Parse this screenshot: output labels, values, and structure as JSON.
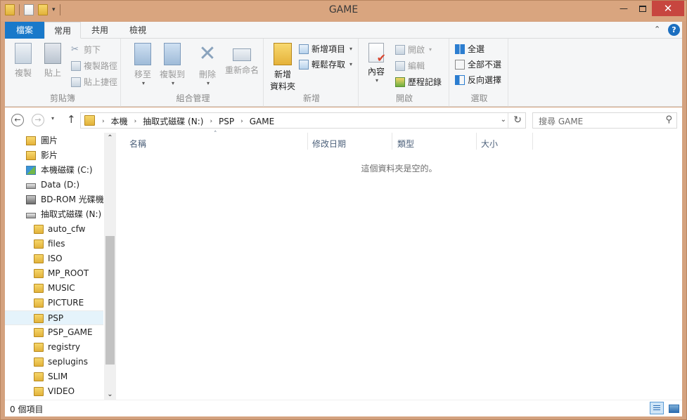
{
  "window": {
    "title": "GAME",
    "close_glyph": "✕",
    "minimize_glyph": "—"
  },
  "quick_access": {
    "icons": [
      "folder-icon",
      "properties-icon",
      "new-folder-icon"
    ],
    "customize_glyph": "▾"
  },
  "ribbon_tabs": [
    {
      "label": "檔案"
    },
    {
      "label": "常用"
    },
    {
      "label": "共用"
    },
    {
      "label": "檢視"
    }
  ],
  "ribbon": {
    "collapse_glyph": "⌃",
    "help_glyph": "?",
    "clipboard": {
      "group_label": "剪貼簿",
      "copy": "複製",
      "paste": "貼上",
      "cut": "剪下",
      "copy_path": "複製路徑",
      "paste_shortcut": "貼上捷徑"
    },
    "organize": {
      "group_label": "組合管理",
      "move_to": "移至",
      "copy_to": "複製到",
      "delete": "刪除",
      "rename": "重新命名"
    },
    "new": {
      "group_label": "新增",
      "new_folder_line1": "新增",
      "new_folder_line2": "資料夾",
      "new_item": "新增項目",
      "easy_access": "輕鬆存取"
    },
    "open": {
      "group_label": "開啟",
      "properties": "內容",
      "open": "開啟",
      "edit": "編輯",
      "history": "歷程記錄"
    },
    "select": {
      "group_label": "選取",
      "select_all": "全選",
      "select_none": "全部不選",
      "invert_selection": "反向選擇"
    }
  },
  "navigation": {
    "back_glyph": "←",
    "forward_glyph": "→",
    "recent_glyph": "▾",
    "up_glyph": "↑",
    "breadcrumb": [
      "本機",
      "抽取式磁碟 (N:)",
      "PSP",
      "GAME"
    ],
    "crumb_separator": "›",
    "address_dropdown_glyph": "⌄",
    "refresh_glyph": "↻",
    "search_placeholder": "搜尋 GAME",
    "search_glyph": "⚲"
  },
  "tree": {
    "items": [
      {
        "label": "圖片",
        "icon": "pictures-icon"
      },
      {
        "label": "影片",
        "icon": "videos-icon"
      },
      {
        "label": "本機磁碟 (C:)",
        "icon": "system-drive-icon"
      },
      {
        "label": "Data (D:)",
        "icon": "drive-icon"
      },
      {
        "label": "BD-ROM 光碟機",
        "icon": "optical-drive-icon"
      },
      {
        "label": "抽取式磁碟 (N:)",
        "icon": "removable-drive-icon"
      },
      {
        "label": "auto_cfw",
        "icon": "folder-icon"
      },
      {
        "label": "files",
        "icon": "folder-icon"
      },
      {
        "label": "ISO",
        "icon": "folder-icon"
      },
      {
        "label": "MP_ROOT",
        "icon": "folder-icon"
      },
      {
        "label": "MUSIC",
        "icon": "folder-icon"
      },
      {
        "label": "PICTURE",
        "icon": "folder-icon"
      },
      {
        "label": "PSP",
        "icon": "folder-icon",
        "selected": true
      },
      {
        "label": "PSP_GAME",
        "icon": "folder-icon"
      },
      {
        "label": "registry",
        "icon": "folder-icon"
      },
      {
        "label": "seplugins",
        "icon": "folder-icon"
      },
      {
        "label": "SLIM",
        "icon": "folder-icon"
      },
      {
        "label": "VIDEO",
        "icon": "folder-icon"
      }
    ],
    "scroll_up_glyph": "⌃",
    "scroll_down_glyph": "⌄"
  },
  "content": {
    "columns": [
      "名稱",
      "修改日期",
      "類型",
      "大小"
    ],
    "sort_glyph": "˄",
    "empty_message": "這個資料夾是空的。"
  },
  "status": {
    "item_count": "0 個項目"
  }
}
